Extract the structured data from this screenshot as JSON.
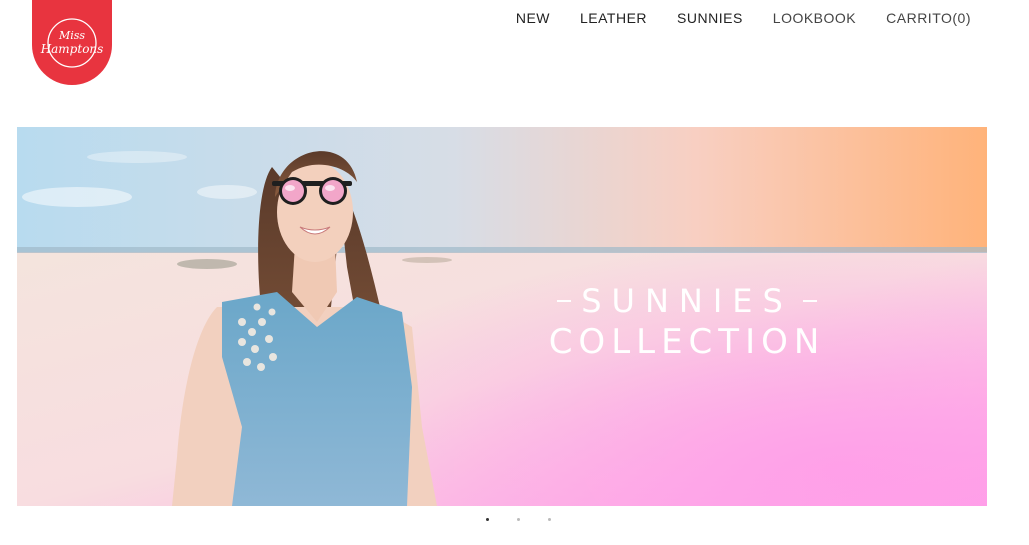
{
  "brand": {
    "logo_text_line1": "Miss",
    "logo_text_line2": "Hamptons",
    "logo_color": "#e8343f"
  },
  "nav": {
    "items": [
      {
        "label": "NEW"
      },
      {
        "label": "LEATHER"
      },
      {
        "label": "SUNNIES"
      },
      {
        "label": "LOOKBOOK"
      },
      {
        "label": "CARRITO(0)"
      }
    ]
  },
  "hero": {
    "line1": "SUNNIES",
    "line2": "COLLECTION",
    "gradient_colors": [
      "#bfe0f0",
      "#f9d3c4",
      "#ffb57a",
      "#ff9fe8"
    ]
  },
  "slider": {
    "dots": 3,
    "active_index": 0
  }
}
